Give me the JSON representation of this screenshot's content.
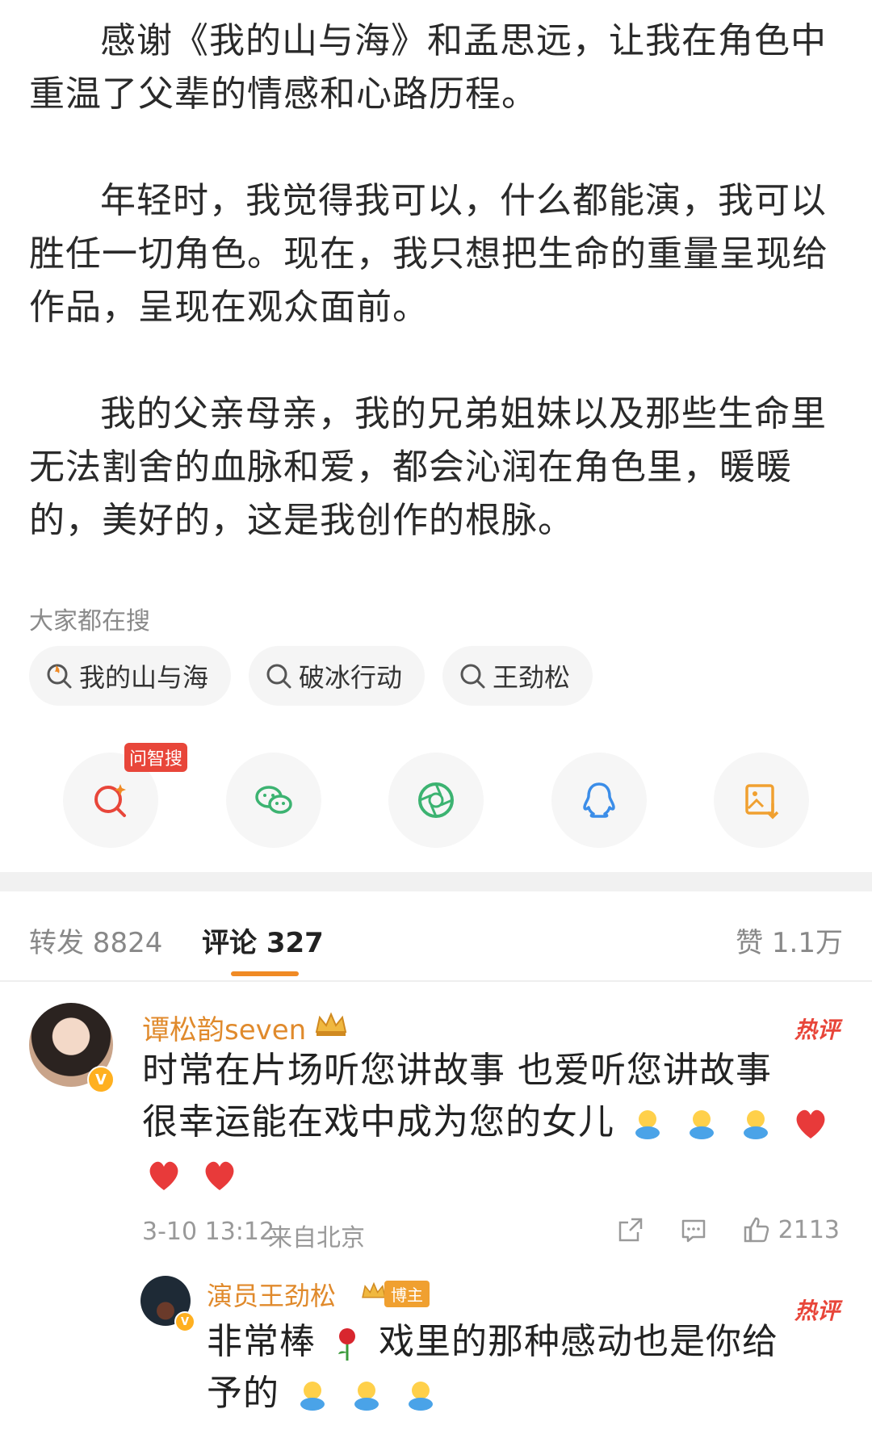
{
  "article": {
    "paragraphs": [
      "感谢《我的山与海》和孟思远，让我在角色中重温了父辈的情感和心路历程。",
      "年轻时，我觉得我可以，什么都能演，我可以胜任一切角色。现在，我只想把生命的重量呈现给作品，呈现在观众面前。",
      "我的父亲母亲，我的兄弟姐妹以及那些生命里无法割舍的血脉和爱，都会沁润在角色里，暖暖的，美好的，这是我创作的根脉。"
    ]
  },
  "search": {
    "title": "大家都在搜",
    "chips": [
      {
        "label": "我的山与海",
        "icon": "hot-search-icon"
      },
      {
        "label": "破冰行动",
        "icon": "search-icon"
      },
      {
        "label": "王劲松",
        "icon": "search-icon"
      }
    ]
  },
  "share": {
    "badge": "问智搜",
    "buttons": [
      "zhisou-icon",
      "wechat-icon",
      "moments-icon",
      "qq-icon",
      "save-image-icon"
    ]
  },
  "tabs": {
    "repost": "转发 8824",
    "comments": "评论 327",
    "likes": "赞 1.1万"
  },
  "comments": [
    {
      "user": "谭松韵seven",
      "hot_label": "热评",
      "lines": [
        "时常在片场听您讲故事 也爱听您讲故事",
        "很幸运能在戏中成为您的女儿"
      ],
      "time": "3-10 13:12",
      "location": "来自北京",
      "likes": "2113",
      "verified_badge": "V"
    },
    {
      "user": "演员王劲松",
      "author_tag": "博主",
      "hot_label": "热评",
      "line1_a": "非常棒",
      "line1_b": "戏里的那种感动也是你给",
      "line2": "予的",
      "verified_badge": "V"
    }
  ],
  "colors": {
    "accent": "#f08a24",
    "username": "#e08a2c",
    "hot": "#e8463a"
  }
}
